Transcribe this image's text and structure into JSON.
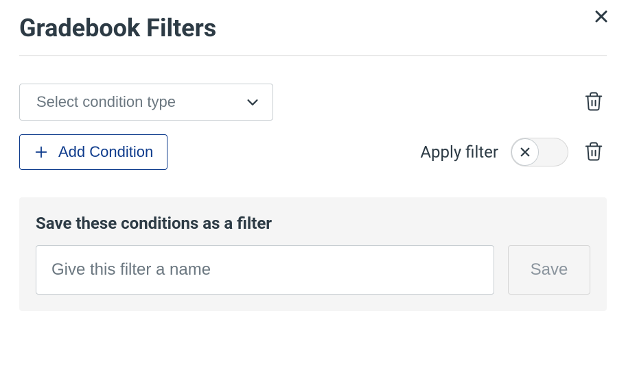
{
  "header": {
    "title": "Gradebook Filters"
  },
  "conditions": {
    "select_placeholder": "Select condition type",
    "add_button_label": "Add Condition"
  },
  "apply": {
    "label": "Apply filter",
    "toggle_on": false
  },
  "save_panel": {
    "title": "Save these conditions as a filter",
    "input_placeholder": "Give this filter a name",
    "input_value": "",
    "save_button_label": "Save"
  },
  "icons": {
    "close": "close-icon",
    "chevron_down": "chevron-down-icon",
    "trash": "trash-icon",
    "plus": "plus-icon",
    "x_small": "x-icon"
  }
}
